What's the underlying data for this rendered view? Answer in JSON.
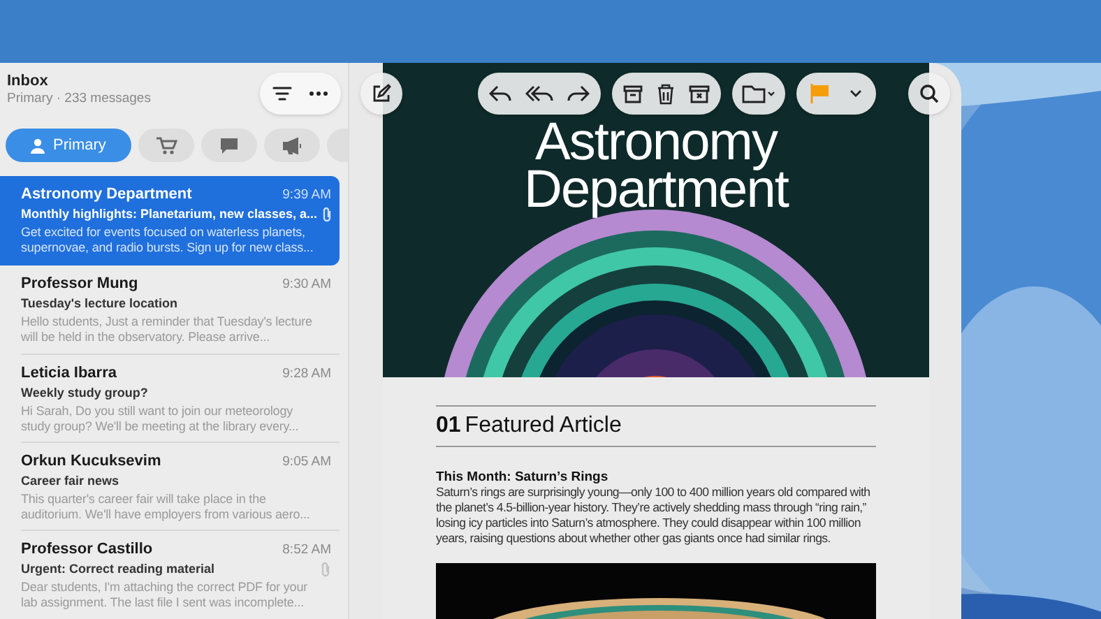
{
  "mailbox": {
    "title": "Inbox",
    "subtitle": "Primary · 233 messages"
  },
  "categories": [
    {
      "kind": "person",
      "label": "Primary",
      "selected": true
    },
    {
      "kind": "cart",
      "selected": false
    },
    {
      "kind": "chat",
      "selected": false
    },
    {
      "kind": "megaphone",
      "selected": false
    },
    {
      "kind": "more",
      "selected": false
    }
  ],
  "messages": [
    {
      "sender": "Astronomy Department",
      "time": "9:39 AM",
      "subject": "Monthly highlights: Planetarium, new classes, a...",
      "preview": "Get excited for events focused on waterless planets, supernovae, and radio bursts. Sign up for new class...",
      "selected": true,
      "attachment": true
    },
    {
      "sender": "Professor Mung",
      "time": "9:30 AM",
      "subject": "Tuesday's lecture location",
      "preview": "Hello students, Just a reminder that Tuesday's lecture will be held in the observatory. Please arrive...",
      "selected": false,
      "attachment": false
    },
    {
      "sender": "Leticia Ibarra",
      "time": "9:28 AM",
      "subject": "Weekly study group?",
      "preview": "Hi Sarah, Do you still want to join our meteorology study group? We'll be meeting at the library every...",
      "selected": false,
      "attachment": false
    },
    {
      "sender": "Orkun Kucuksevim",
      "time": "9:05 AM",
      "subject": "Career fair news",
      "preview": "This quarter's career fair will take place in the auditorium. We'll have employers from various aero...",
      "selected": false,
      "attachment": false
    },
    {
      "sender": "Professor Castillo",
      "time": "8:52 AM",
      "subject": "Urgent: Correct reading material",
      "preview": "Dear students, I'm attaching the correct PDF for your lab assignment. The last file I sent was incomplete...",
      "selected": false,
      "attachment": true
    }
  ],
  "email": {
    "hero_title": "Astronomy Department",
    "section_number": "01",
    "section_title": "Featured Article",
    "article_title": "This Month: Saturn’s Rings",
    "article_body": "Saturn’s rings are surprisingly young—only 100 to 400 million years old compared with the planet’s 4.5-billion-year history. They’re actively shedding mass through “ring rain,” losing icy particles into Saturn’s atmosphere. They could disappear within 100 million years, raising questions about whether other gas giants once had similar rings."
  }
}
